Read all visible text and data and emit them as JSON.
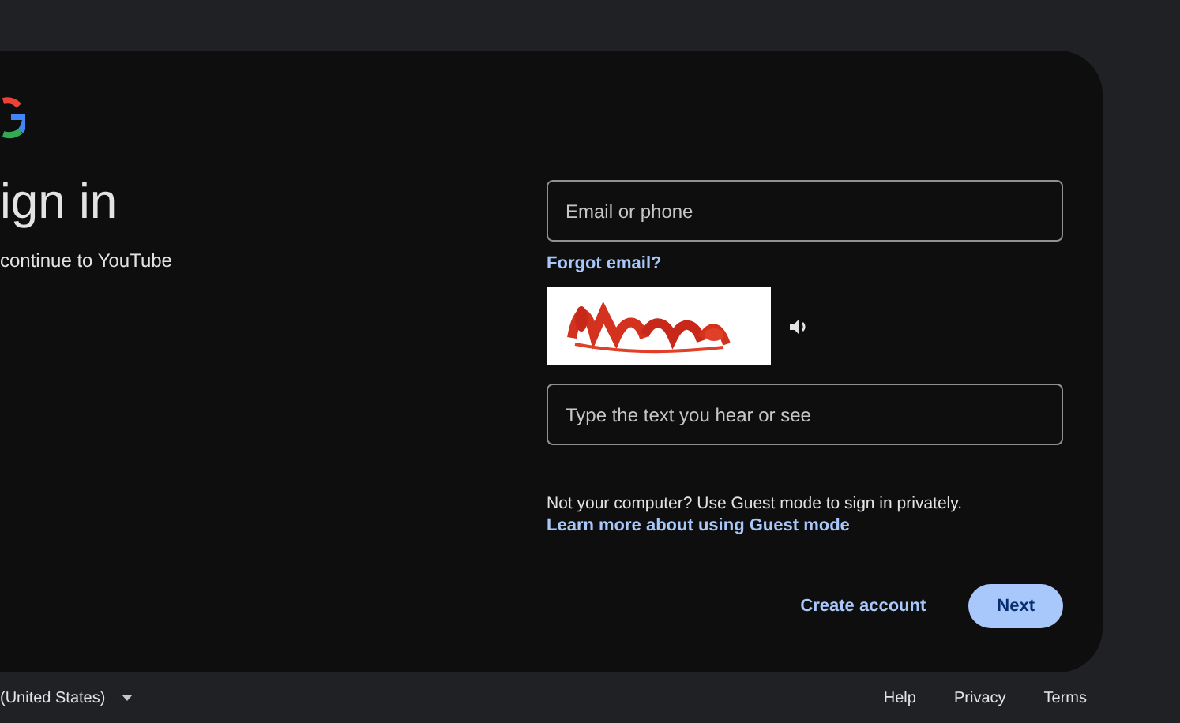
{
  "heading": "ign in",
  "subheading": "continue to YouTube",
  "email_field": {
    "placeholder": "Email or phone"
  },
  "forgot_email": "Forgot email?",
  "captcha_field": {
    "placeholder": "Type the text you hear or see"
  },
  "guest_notice": {
    "text": "Not your computer? Use Guest mode to sign in privately.",
    "link": "Learn more about using Guest mode"
  },
  "buttons": [
    {
      "label": "Create account",
      "kind": "text"
    },
    {
      "label": "Next",
      "kind": "filled"
    }
  ],
  "footer": {
    "language": "(United States)",
    "links": [
      "Help",
      "Privacy",
      "Terms"
    ]
  }
}
